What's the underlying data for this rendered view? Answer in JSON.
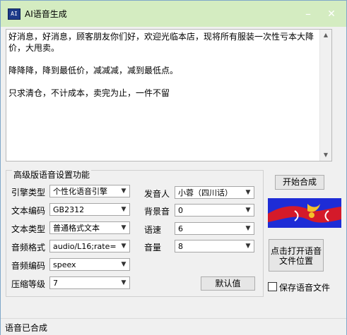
{
  "window": {
    "title": "AI语音生成",
    "icon_text": "AI",
    "minimize_glyph": "–",
    "close_glyph": "✕"
  },
  "textarea": {
    "text": "好消息，好消息，顾客朋友你们好，欢迎光临本店，现将所有服装一次性亏本大降价，大甩卖。\n\n降降降，降到最低价，减减减，减到最低点。\n\n只求清仓，不计成本，卖完为止，一件不留"
  },
  "settings": {
    "group_title": "高级版语音设置功能",
    "engine": {
      "label": "引擎类型",
      "value": "个性化语音引擎"
    },
    "encoding": {
      "label": "文本编码",
      "value": "GB2312"
    },
    "text_type": {
      "label": "文本类型",
      "value": "普通格式文本"
    },
    "audio_format": {
      "label": "音频格式",
      "value": "audio/L16;rate="
    },
    "audio_codec": {
      "label": "音频编码",
      "value": "speex"
    },
    "compression": {
      "label": "压缩等级",
      "value": "7"
    },
    "speaker": {
      "label": "发音人",
      "value": "小蓉（四川话）"
    },
    "bg_sound": {
      "label": "背景音",
      "value": "0"
    },
    "speed": {
      "label": "语速",
      "value": "6"
    },
    "volume": {
      "label": "音量",
      "value": "8"
    },
    "default_button": "默认值"
  },
  "actions": {
    "start_button": "开始合成",
    "open_location_line1": "点击打开语音",
    "open_location_line2": "文件位置",
    "save_checkbox_label": "保存语音文件"
  },
  "status": {
    "text": "语音已合成"
  },
  "colors": {
    "titlebar": "#d4ecc1",
    "logo_blue": "#1e2cd6",
    "logo_red": "#d41a2a"
  },
  "icons": {
    "dropdown": "chevron-down-icon",
    "scroll_up": "arrow-up-icon",
    "scroll_down": "arrow-down-icon"
  }
}
